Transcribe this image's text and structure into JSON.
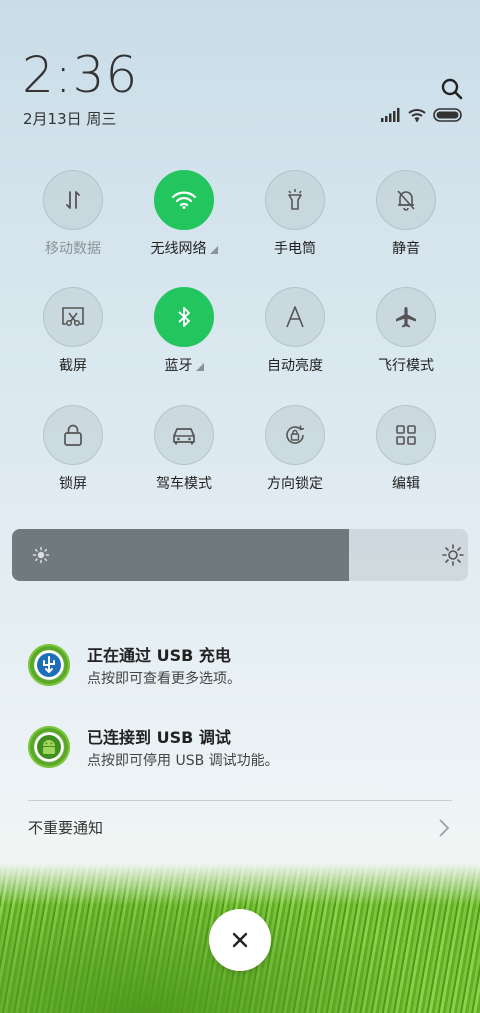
{
  "status_bar": {
    "time": "2:36",
    "date": "2月13日 周三",
    "icons": [
      "search-icon",
      "signal-icon",
      "wifi-icon",
      "battery-icon"
    ]
  },
  "quick_tiles": [
    {
      "label": "移动数据",
      "icon": "mobile-data-icon",
      "active": false,
      "dim": true,
      "expandable": false
    },
    {
      "label": "无线网络",
      "icon": "wifi-icon",
      "active": true,
      "dim": false,
      "expandable": true
    },
    {
      "label": "手电筒",
      "icon": "flashlight-icon",
      "active": false,
      "dim": false,
      "expandable": false
    },
    {
      "label": "静音",
      "icon": "mute-bell-icon",
      "active": false,
      "dim": false,
      "expandable": false
    },
    {
      "label": "截屏",
      "icon": "screenshot-icon",
      "active": false,
      "dim": false,
      "expandable": false
    },
    {
      "label": "蓝牙",
      "icon": "bluetooth-icon",
      "active": true,
      "dim": false,
      "expandable": true
    },
    {
      "label": "自动亮度",
      "icon": "auto-brightness-icon",
      "active": false,
      "dim": false,
      "expandable": false
    },
    {
      "label": "飞行模式",
      "icon": "airplane-icon",
      "active": false,
      "dim": false,
      "expandable": false
    },
    {
      "label": "锁屏",
      "icon": "lock-icon",
      "active": false,
      "dim": false,
      "expandable": false
    },
    {
      "label": "驾车模式",
      "icon": "car-icon",
      "active": false,
      "dim": false,
      "expandable": false
    },
    {
      "label": "方向锁定",
      "icon": "rotation-lock-icon",
      "active": false,
      "dim": false,
      "expandable": false
    },
    {
      "label": "编辑",
      "icon": "grid-edit-icon",
      "active": false,
      "dim": false,
      "expandable": false
    }
  ],
  "brightness": {
    "level": 0.74
  },
  "notifications": [
    {
      "title": "正在通过 USB 充电",
      "body": "点按即可查看更多选项。",
      "icon": "usb-icon"
    },
    {
      "title": "已连接到 USB 调试",
      "body": "点按即可停用 USB 调试功能。",
      "icon": "android-debug-icon"
    }
  ],
  "unimportant": {
    "label": "不重要通知"
  },
  "colors": {
    "active_tile": "#22c55e",
    "brightness_fill": "#707a7e"
  }
}
